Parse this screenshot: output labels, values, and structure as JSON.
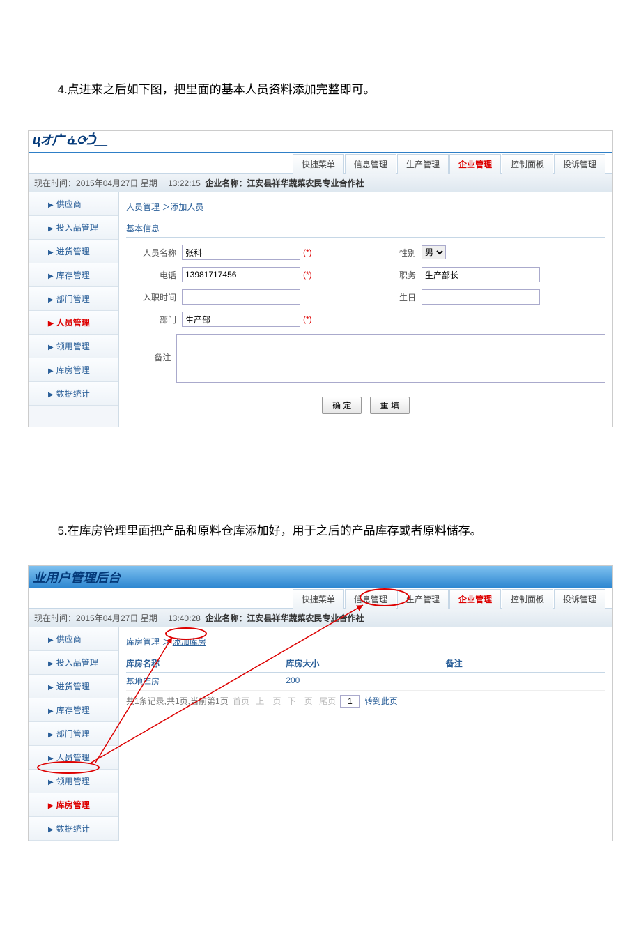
{
  "doc": {
    "step4": "4.点进来之后如下图，把里面的基本人员资料添加完整即可。",
    "step5": "5.在库房管理里面把产品和原料仓库添加好，用于之后的产品库存或者原料储存。"
  },
  "app1": {
    "logo": "цオ广 ᓈ⟳ᑑ＿",
    "tabs": [
      {
        "label": "快捷菜单",
        "active": false
      },
      {
        "label": "信息管理",
        "active": false
      },
      {
        "label": "生产管理",
        "active": false
      },
      {
        "label": "企业管理",
        "active": true
      },
      {
        "label": "控制面板",
        "active": false
      },
      {
        "label": "投诉管理",
        "active": false
      }
    ],
    "time_prefix": "现在时间：",
    "time_value": "2015年04月27日 星期一 13:22:15",
    "company_prefix": "企业名称：",
    "company_value": "江安县祥华蔬菜农民专业合作社",
    "sidebar": [
      {
        "label": "供应商",
        "active": false
      },
      {
        "label": "投入品管理",
        "active": false
      },
      {
        "label": "进货管理",
        "active": false
      },
      {
        "label": "库存管理",
        "active": false
      },
      {
        "label": "部门管理",
        "active": false
      },
      {
        "label": "人员管理",
        "active": true
      },
      {
        "label": "领用管理",
        "active": false
      },
      {
        "label": "库房管理",
        "active": false
      },
      {
        "label": "数据统计",
        "active": false
      }
    ],
    "breadcrumb": "人员管理 ＞添加人员",
    "section": "基本信息",
    "fields": {
      "name_label": "人员名称",
      "name_value": "张科",
      "gender_label": "性别",
      "gender_value": "男",
      "phone_label": "电话",
      "phone_value": "13981717456",
      "position_label": "职务",
      "position_value": "生产部长",
      "hiredate_label": "入职时间",
      "hiredate_value": "",
      "birthday_label": "生日",
      "birthday_value": "",
      "dept_label": "部门",
      "dept_value": "生产部",
      "remark_label": "备注",
      "remark_value": "",
      "required": "(*)"
    },
    "buttons": {
      "ok": "确 定",
      "reset": "重 填"
    }
  },
  "app2": {
    "logo": "业用户管理后台",
    "tabs": [
      {
        "label": "快捷菜单",
        "active": false
      },
      {
        "label": "信息管理",
        "active": false
      },
      {
        "label": "生产管理",
        "active": false
      },
      {
        "label": "企业管理",
        "active": true
      },
      {
        "label": "控制面板",
        "active": false
      },
      {
        "label": "投诉管理",
        "active": false
      }
    ],
    "time_prefix": "现在时间：",
    "time_value": "2015年04月27日 星期一 13:40:28",
    "company_prefix": "企业名称：",
    "company_value": "江安县祥华蔬菜农民专业合作社",
    "sidebar": [
      {
        "label": "供应商",
        "active": false
      },
      {
        "label": "投入品管理",
        "active": false
      },
      {
        "label": "进货管理",
        "active": false
      },
      {
        "label": "库存管理",
        "active": false
      },
      {
        "label": "部门管理",
        "active": false
      },
      {
        "label": "人员管理",
        "active": false
      },
      {
        "label": "领用管理",
        "active": false
      },
      {
        "label": "库房管理",
        "active": true
      },
      {
        "label": "数据统计",
        "active": false
      }
    ],
    "breadcrumb_a": "库房管理",
    "breadcrumb_b": "添加库房",
    "breadcrumb_sep": "＞",
    "columns": {
      "name": "库房名称",
      "size": "库房大小",
      "remark": "备注"
    },
    "rows": [
      {
        "name": "基地库房",
        "size": "200",
        "remark": ""
      }
    ],
    "pager": {
      "summary": "共1条记录,共1页,当前第1页",
      "first": "首页",
      "prev": "上一页",
      "next": "下一页",
      "last": "尾页",
      "page": "1",
      "goto": "转到此页"
    }
  }
}
